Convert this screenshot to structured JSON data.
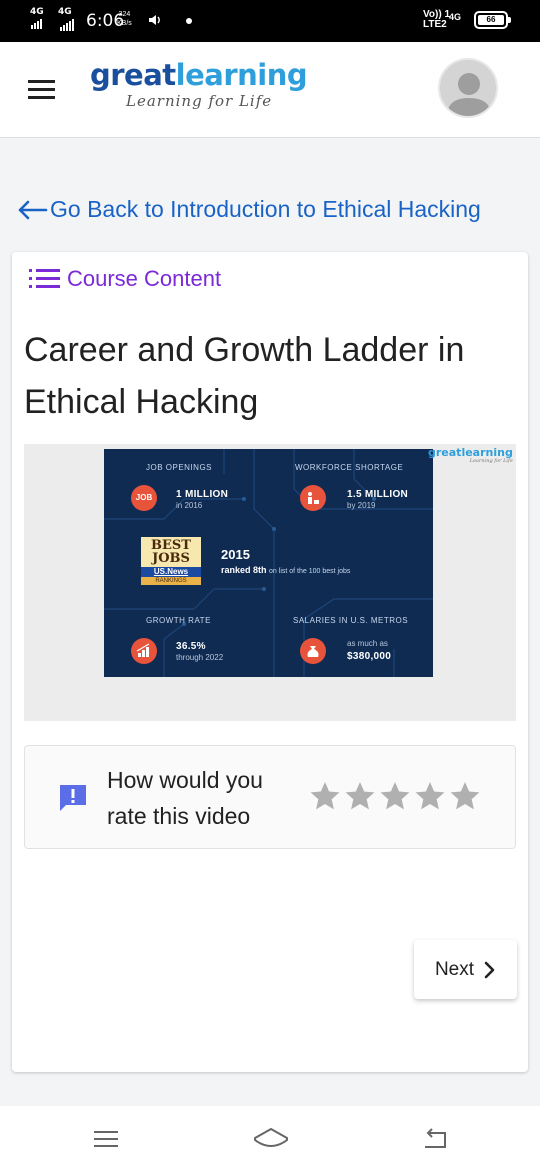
{
  "status_bar": {
    "sim1_network": "4G",
    "sim2_network": "4G",
    "time": "6:06",
    "net_speed_value": "324",
    "net_speed_unit": "KB/s",
    "volte_line1": "Vo)) 1",
    "volte_line2": "LTE2",
    "network_4g": "4G",
    "battery": "66"
  },
  "header": {
    "logo_part1": "great",
    "logo_part2": "learning",
    "tagline": "Learning for Life",
    "menu_icon": "hamburger-icon",
    "avatar_icon": "user-avatar-icon"
  },
  "back_link": {
    "label": "Go Back to Introduction to Ethical Hacking",
    "icon": "arrow-left-icon"
  },
  "course_content": {
    "label": "Course Content",
    "icon": "list-icon"
  },
  "lesson": {
    "title": "Career and Growth Ladder in Ethical Hacking"
  },
  "video": {
    "logo_word": "greatlearning",
    "logo_tagline": "Learning for Life",
    "infographic": {
      "job_openings_heading": "JOB OPENINGS",
      "job_openings_value": "1 MILLION",
      "job_openings_sub": "in 2016",
      "job_badge": "JOB",
      "shortage_heading": "WORKFORCE SHORTAGE",
      "shortage_value": "1.5 MILLION",
      "shortage_sub": "by 2019",
      "best_jobs_line1": "BEST",
      "best_jobs_line2": "JOBS",
      "best_jobs_news": "US.News",
      "best_jobs_rankings": "RANKINGS",
      "year": "2015",
      "ranked_bold": "ranked 8th",
      "ranked_rest": "on list of the 100 best jobs",
      "growth_heading": "GROWTH RATE",
      "growth_value": "36.5%",
      "growth_sub": "through 2022",
      "salary_heading": "SALARIES IN U.S. METROS",
      "salary_sub": "as much as",
      "salary_value": "$380,000"
    }
  },
  "rating": {
    "prompt": "How would you rate this video",
    "icon": "feedback-message-icon",
    "max_stars": 5,
    "selected_stars": 0,
    "star_color": "#b0b0b0"
  },
  "next_button": {
    "label": "Next",
    "icon": "chevron-right-icon"
  },
  "nav_bar": {
    "recent_icon": "recent-apps-icon",
    "home_icon": "home-icon",
    "back_icon": "back-icon"
  },
  "colors": {
    "brand_dark_blue": "#1a4f9e",
    "brand_light_blue": "#2e9fdb",
    "link_blue": "#1a63c6",
    "course_purple": "#7b2ad6",
    "feedback_icon": "#5b6ee8",
    "infographic_bg": "#0f2b52",
    "infographic_accent": "#e8533b"
  }
}
